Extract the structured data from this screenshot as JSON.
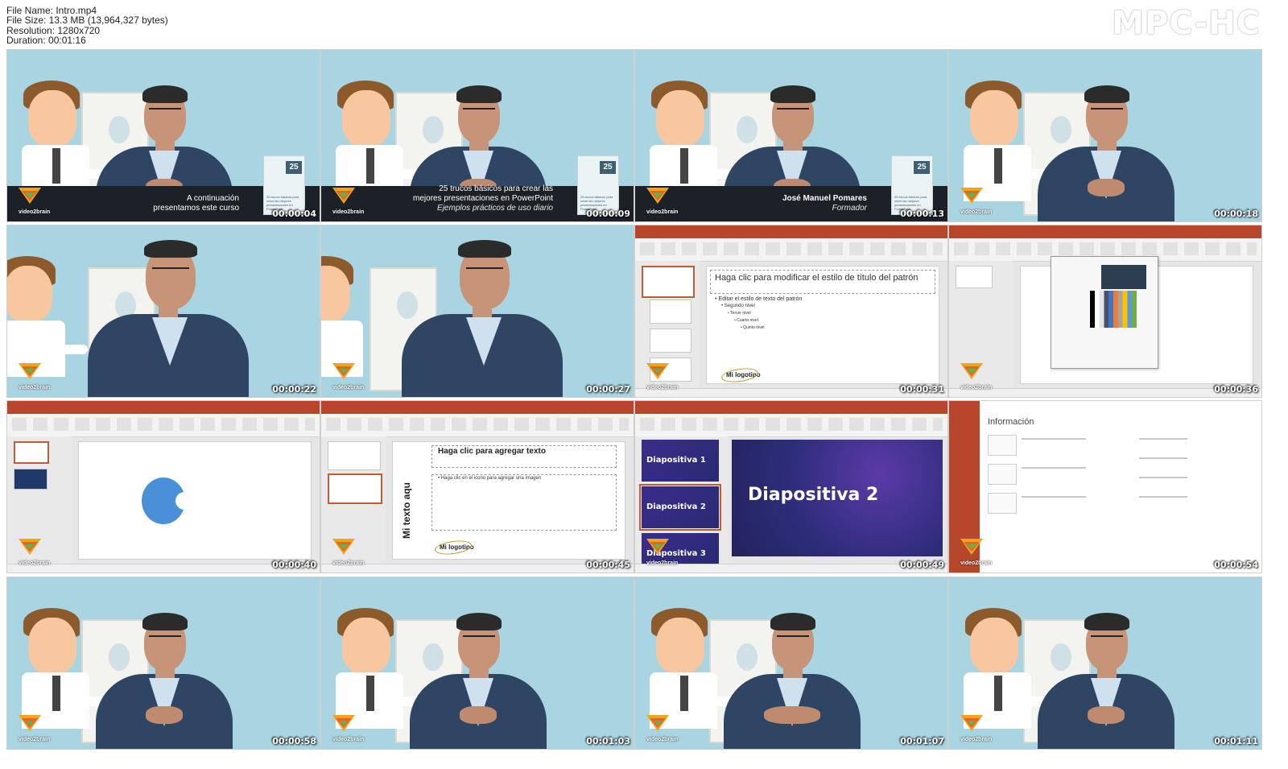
{
  "header": {
    "file_name": "File Name: Intro.mp4",
    "file_size": "File Size: 13.3 MB (13,964,327 bytes)",
    "resolution": "Resolution: 1280x720",
    "duration": "Duration: 00:01:16",
    "brand": "MPC-HC"
  },
  "common": {
    "channel_logo": "video2brain",
    "course_number": "25",
    "course_card_text": "25 trucos básicos para crear las mejores presentaciones en PowerPoint"
  },
  "thumbnails": [
    {
      "timestamp": "00:00:04",
      "caption_line1": "A continuación",
      "caption_line2": "presentamos este curso"
    },
    {
      "timestamp": "00:00:09",
      "caption_line1": "25 trucos básicos para crear las",
      "caption_line2": "mejores presentaciones en PowerPoint",
      "caption_line3": "Ejemplos prácticos de uso diario"
    },
    {
      "timestamp": "00:00:13",
      "caption_line1": "José Manuel Pomares",
      "caption_line2": "Formador"
    },
    {
      "timestamp": "00:00:18"
    },
    {
      "timestamp": "00:00:22"
    },
    {
      "timestamp": "00:00:27"
    },
    {
      "timestamp": "00:00:31",
      "slide_title": "Haga clic para modificar el estilo de título del patrón",
      "bullet1": "• Editar el estilo de texto del patrón",
      "bullet2": "• Segundo nivel",
      "bullet3": "• Tercer nivel",
      "bullet4": "• Cuarto nivel",
      "bullet5": "• Quinto nivel",
      "logo_text": "Mi logotipo"
    },
    {
      "timestamp": "00:00:36"
    },
    {
      "timestamp": "00:00:40"
    },
    {
      "timestamp": "00:00:45",
      "title_text": "Haga clic para agregar texto",
      "body_text": "• Haga clic en el icono para agregar una imagen",
      "vertical_text": "Mi texto aqu",
      "logo_text": "Mi logotipo"
    },
    {
      "timestamp": "00:00:49",
      "slide1": "Diapositiva 1",
      "slide2": "Diapositiva 2",
      "slide3": "Diapositiva 3",
      "main_slide": "Diapositiva 2"
    },
    {
      "timestamp": "00:00:54",
      "info_title": "Información"
    },
    {
      "timestamp": "00:00:58"
    },
    {
      "timestamp": "00:01:03"
    },
    {
      "timestamp": "00:01:07"
    },
    {
      "timestamp": "00:01:11"
    }
  ]
}
